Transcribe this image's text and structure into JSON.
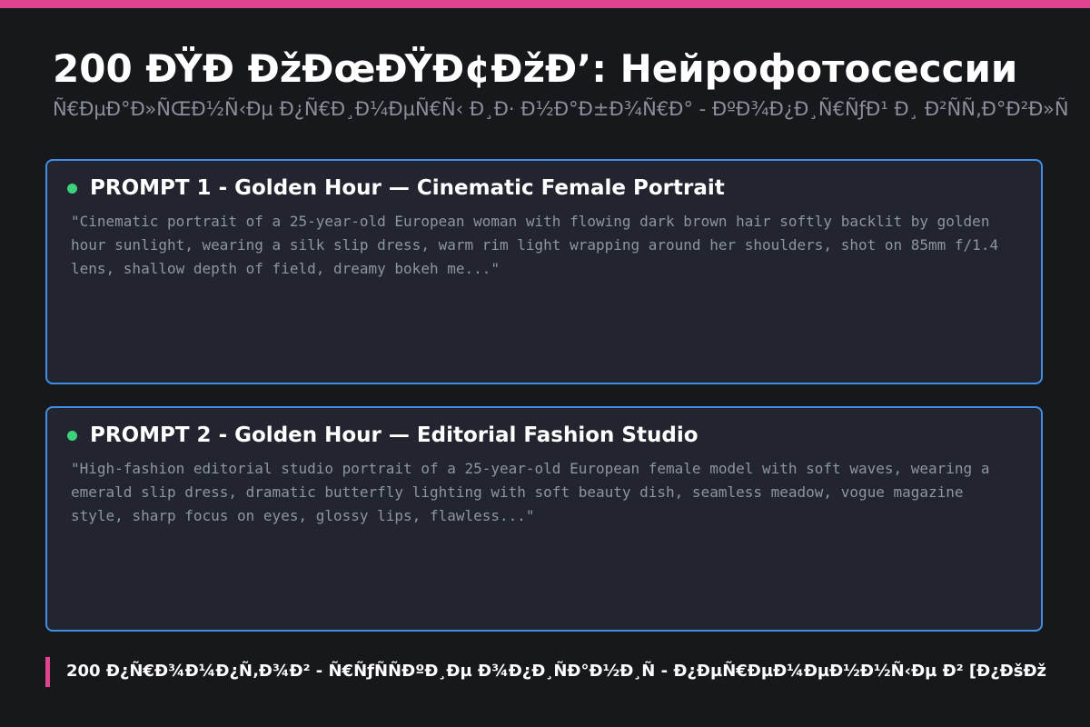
{
  "header": {
    "title": "200 ÐŸÐ ÐžÐœÐŸÐ¢ÐžÐ’: Нейрофотосессии",
    "subtitle": "Ñ€ÐµÐ°Ð»ÑŒÐ½Ñ‹Ðµ Ð¿Ñ€Ð¸Ð¼ÐµÑ€Ñ‹ Ð¸Ð· Ð½Ð°Ð±Ð¾Ñ€Ð° - ÐºÐ¾Ð¿Ð¸Ñ€ÑƒÐ¹ Ð¸ Ð²ÑÑ‚Ð°Ð²Ð»Ñ"
  },
  "prompts": [
    {
      "title": "PROMPT 1 - Golden Hour — Cinematic Female Portrait",
      "text": "\"Cinematic portrait of a 25-year-old European woman with flowing dark brown hair softly backlit by golden hour sunlight, wearing a silk slip dress, warm rim light wrapping around her shoulders, shot on 85mm f/1.4 lens, shallow depth of field, dreamy bokeh me...\""
    },
    {
      "title": "PROMPT 2 - Golden Hour — Editorial Fashion Studio",
      "text": "\"High-fashion editorial studio portrait of a 25-year-old European female model with soft waves, wearing a emerald slip dress, dramatic butterfly lighting with soft beauty dish, seamless meadow, vogue magazine style, sharp focus on eyes, glossy lips, flawless...\""
    }
  ],
  "footer": {
    "text": "200 Ð¿Ñ€Ð¾Ð¼Ð¿Ñ‚Ð¾Ð² - Ñ€ÑƒÑÑÐºÐ¸Ðµ Ð¾Ð¿Ð¸ÑÐ°Ð½Ð¸Ñ - Ð¿ÐµÑ€ÐµÐ¼ÐµÐ½Ð½Ñ‹Ðµ Ð² [Ð¿ÐšÐž"
  },
  "colors": {
    "accent": "#e0448f",
    "card_border": "#3f8ee8",
    "status_dot": "#3ed17a",
    "background": "#17181c",
    "card_background": "#22252f"
  }
}
